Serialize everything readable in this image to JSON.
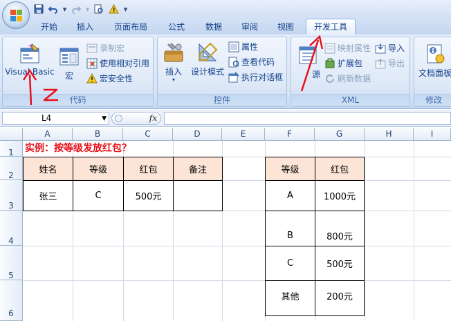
{
  "quick_access": [
    "save-icon",
    "undo-icon",
    "redo-icon",
    "print-preview-icon",
    "warning-icon",
    "customize-icon"
  ],
  "tabs": [
    {
      "label": "开始",
      "active": false
    },
    {
      "label": "插入",
      "active": false
    },
    {
      "label": "页面布局",
      "active": false
    },
    {
      "label": "公式",
      "active": false
    },
    {
      "label": "数据",
      "active": false
    },
    {
      "label": "审阅",
      "active": false
    },
    {
      "label": "视图",
      "active": false
    },
    {
      "label": "开发工具",
      "active": true
    }
  ],
  "ribbon": {
    "code": {
      "label": "代码",
      "visual_basic": "Visual Basic",
      "macros": "宏",
      "record_macro": "录制宏",
      "relative_refs": "使用相对引用",
      "macro_security": "宏安全性"
    },
    "controls": {
      "label": "控件",
      "insert": "插入",
      "design_mode": "设计模式",
      "properties": "属性",
      "view_code": "查看代码",
      "run_dialog": "执行对话框"
    },
    "xml": {
      "label": "XML",
      "source": "源",
      "map_properties": "映射属性",
      "expansion_packs": "扩展包",
      "refresh_data": "刷新数据",
      "import": "导入",
      "export": "导出"
    },
    "modify": {
      "label": "修改",
      "document_panel": "文档面板"
    }
  },
  "formula_bar": {
    "name_box": "L4",
    "fx": "fx",
    "formula": ""
  },
  "columns": [
    "A",
    "B",
    "C",
    "D",
    "E",
    "F",
    "G",
    "H",
    "I"
  ],
  "rows": [
    "1",
    "2",
    "3",
    "4",
    "5",
    "6"
  ],
  "sheet": {
    "title": "实例：按等级发放红包？",
    "left_headers": [
      "姓名",
      "等级",
      "红包",
      "备注"
    ],
    "left_row": [
      "张三",
      "C",
      "500元",
      ""
    ],
    "right_headers": [
      "等级",
      "红包"
    ],
    "right_rows": [
      [
        "A",
        "1000元"
      ],
      [
        "B",
        "800元"
      ],
      [
        "C",
        "500元"
      ],
      [
        "其他",
        "200元"
      ]
    ]
  },
  "annotations": {
    "z_mark": "Z"
  },
  "colors": {
    "accent": "#e8101a",
    "header_fill": "#fce4d6",
    "ribbon": "#dbe6f6"
  }
}
